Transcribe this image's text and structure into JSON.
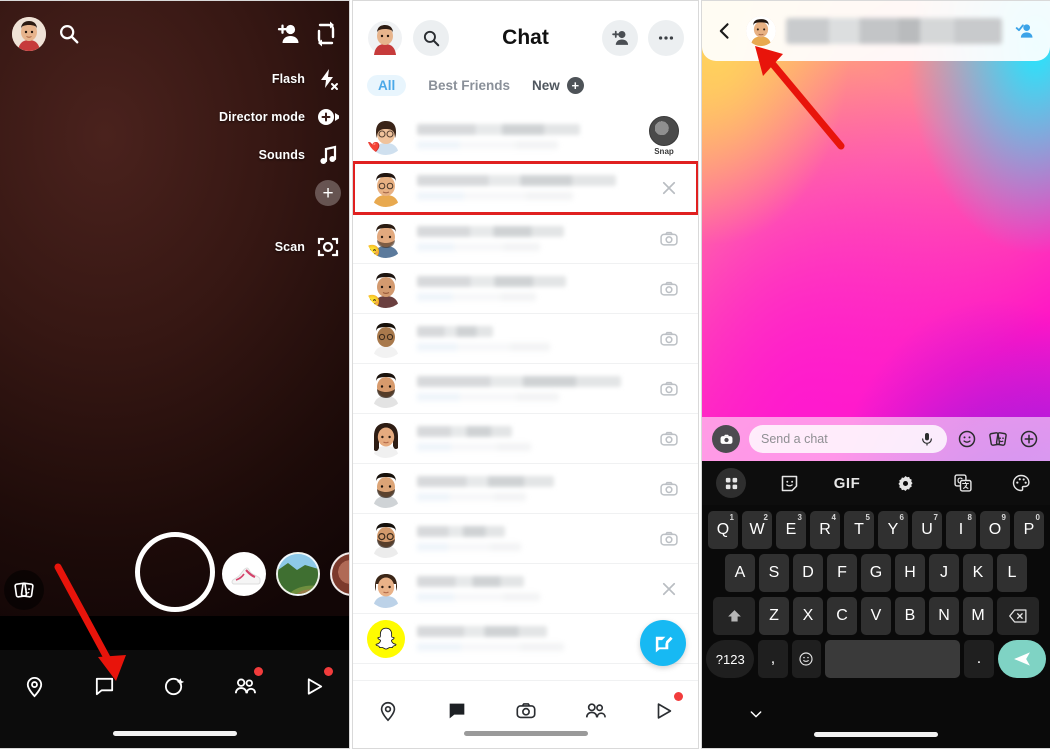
{
  "app": {
    "name": "Snapchat"
  },
  "camera": {
    "top": {
      "profile_icon": "bitmoji-avatar",
      "search_icon": "search-icon",
      "add_friend_icon": "add-friend-icon",
      "flip_camera_icon": "flip-camera-icon"
    },
    "rail": [
      {
        "label": "Flash",
        "icon": "flash-off-icon"
      },
      {
        "label": "Director mode",
        "icon": "director-mode-icon"
      },
      {
        "label": "Sounds",
        "icon": "music-note-icon"
      },
      {
        "label": "",
        "icon": "plus-icon"
      },
      {
        "label": "Scan",
        "icon": "scan-icon"
      }
    ],
    "lens_sticker_icon": "stickers-icon",
    "shutter_label": "shutter-button",
    "carousel": [
      "lens-shoe",
      "lens-landscape",
      "lens-partial"
    ],
    "nav": [
      {
        "icon": "map-pin-icon",
        "badge": false
      },
      {
        "icon": "chat-bubble-icon",
        "badge": false
      },
      {
        "icon": "camera-lens-icon",
        "badge": false
      },
      {
        "icon": "friends-icon",
        "badge": true
      },
      {
        "icon": "play-icon",
        "badge": true
      }
    ]
  },
  "chat": {
    "header": {
      "profile_icon": "bitmoji-avatar",
      "search_icon": "search-icon",
      "title": "Chat",
      "add_friend_icon": "add-friend-icon",
      "more_icon": "more-options-icon"
    },
    "tabs": [
      {
        "label": "All",
        "selected": true
      },
      {
        "label": "Best Friends",
        "selected": false
      }
    ],
    "new_tab": {
      "label": "New",
      "plus": "+"
    },
    "rows": [
      {
        "avatar": "female-glasses",
        "badge": "❤️",
        "right": "snap-thumbnail",
        "right_label": "Snap",
        "selected": false,
        "w1": 72,
        "w2": 62
      },
      {
        "avatar": "male-glasses",
        "badge": "",
        "right": "close-icon",
        "right_label": "",
        "selected": true,
        "w1": 84,
        "w2": 66
      },
      {
        "avatar": "male-beard",
        "badge": "😊",
        "right": "camera-icon",
        "right_label": "",
        "selected": false,
        "w1": 62,
        "w2": 52
      },
      {
        "avatar": "male-dark",
        "badge": "😊",
        "right": "camera-icon",
        "right_label": "",
        "selected": false,
        "w1": 63,
        "w2": 50
      },
      {
        "avatar": "male-cap",
        "badge": "",
        "right": "camera-icon",
        "right_label": "",
        "selected": false,
        "w1": 32,
        "w2": 56
      },
      {
        "avatar": "male-beard2",
        "badge": "",
        "right": "camera-icon",
        "right_label": "",
        "selected": false,
        "w1": 86,
        "w2": 60
      },
      {
        "avatar": "female-long",
        "badge": "",
        "right": "camera-icon",
        "right_label": "",
        "selected": false,
        "w1": 40,
        "w2": 48
      },
      {
        "avatar": "male-beard3",
        "badge": "",
        "right": "camera-icon",
        "right_label": "",
        "selected": false,
        "w1": 58,
        "w2": 46
      },
      {
        "avatar": "male-glasses2",
        "badge": "",
        "right": "camera-icon",
        "right_label": "",
        "selected": false,
        "w1": 37,
        "w2": 44
      },
      {
        "avatar": "female-bun",
        "badge": "",
        "right": "close-icon",
        "right_label": "",
        "selected": false,
        "w1": 45,
        "w2": 52
      },
      {
        "avatar": "snapchat-ghost",
        "badge": "",
        "right": "",
        "right_label": "",
        "selected": false,
        "w1": 55,
        "w2": 62
      }
    ],
    "compose_fab_icon": "new-chat-icon",
    "nav": [
      {
        "icon": "map-pin-icon",
        "badge": false
      },
      {
        "icon": "chat-bubble-filled-icon",
        "badge": false
      },
      {
        "icon": "camera-icon",
        "badge": false
      },
      {
        "icon": "friends-icon",
        "badge": false
      },
      {
        "icon": "play-icon",
        "badge": true
      }
    ]
  },
  "conversation": {
    "header": {
      "back_icon": "back-chevron-icon",
      "avatar_icon": "bitmoji-avatar",
      "name": "",
      "add_friend_icon": "friend-added-icon"
    },
    "chat_bar": {
      "camera_icon": "camera-circle-icon",
      "placeholder": "Send a chat",
      "value": "",
      "mic_icon": "microphone-icon",
      "sticker_icon": "smiley-sticker-icon",
      "cards_icon": "stickers-icon",
      "plus_icon": "plus-circle-icon"
    },
    "keyboard_toolbar": [
      {
        "icon": "grid-menu-icon"
      },
      {
        "icon": "sticker-face-icon"
      },
      {
        "icon": "gif-icon",
        "label": "GIF"
      },
      {
        "icon": "settings-gear-icon"
      },
      {
        "icon": "translate-icon"
      },
      {
        "icon": "palette-theme-icon"
      }
    ],
    "keyboard": {
      "row1": [
        {
          "k": "Q",
          "n": "1"
        },
        {
          "k": "W",
          "n": "2"
        },
        {
          "k": "E",
          "n": "3"
        },
        {
          "k": "R",
          "n": "4"
        },
        {
          "k": "T",
          "n": "5"
        },
        {
          "k": "Y",
          "n": "6"
        },
        {
          "k": "U",
          "n": "7"
        },
        {
          "k": "I",
          "n": "8"
        },
        {
          "k": "O",
          "n": "9"
        },
        {
          "k": "P",
          "n": "0"
        }
      ],
      "row2": [
        "A",
        "S",
        "D",
        "F",
        "G",
        "H",
        "J",
        "K",
        "L"
      ],
      "row3": [
        "Z",
        "X",
        "C",
        "V",
        "B",
        "N",
        "M"
      ],
      "shift_icon": "shift-key-icon",
      "backspace_icon": "backspace-key-icon",
      "numeric_label": "?123",
      "comma_label": ",",
      "emoji_icon": "emoji-key-icon",
      "space_label": "",
      "period_label": ".",
      "send_icon": "send-key-icon",
      "hide_icon": "hide-keyboard-icon"
    }
  },
  "annotations": {
    "arrow_left": "red-arrow-pointing-to-chat-tab",
    "arrow_right": "red-arrow-pointing-to-profile-avatar",
    "highlight_box": "red-box-around-selected-chat-row"
  },
  "colors": {
    "snap_yellow": "#FFFC00",
    "accent_blue": "#17b9f3",
    "tab_blue": "#4aa8e8",
    "annotation_red": "#e02020",
    "badge_red": "#f23c3c",
    "send_key": "#7fd3c4"
  }
}
